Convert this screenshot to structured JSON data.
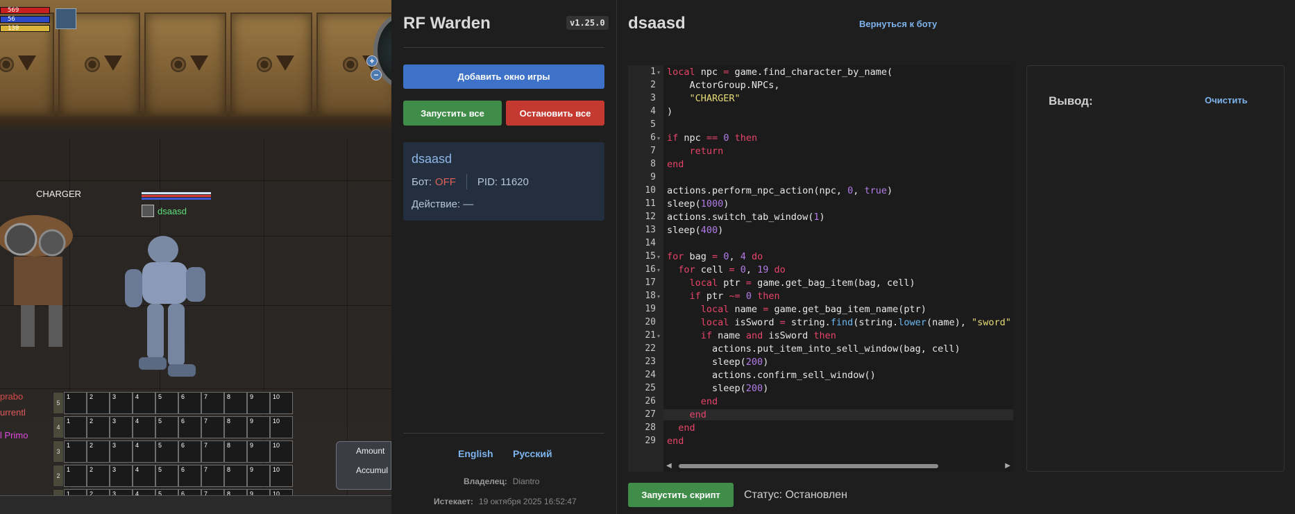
{
  "game": {
    "hp_values": [
      "569",
      "56",
      "130"
    ],
    "npc_label": "CHARGER",
    "player_name": "dsaasd",
    "chat_lines": [
      "prabo",
      "urrentl",
      "l Primo"
    ],
    "hotbar_labels": [
      "1",
      "2",
      "3",
      "4",
      "5",
      "6",
      "7",
      "8",
      "9",
      "10"
    ],
    "row_numbers": [
      "5",
      "4",
      "3",
      "2",
      "1"
    ],
    "amount_label": "Amount",
    "accumul_label": "Accumul"
  },
  "sidebar": {
    "app_title": "RF Warden",
    "version": "v1.25.0",
    "add_window_button": "Добавить окно игры",
    "start_all_button": "Запустить все",
    "stop_all_button": "Остановить все",
    "bot_card": {
      "name": "dsaasd",
      "bot_label": "Бот:",
      "bot_state": "OFF",
      "pid": "PID: 11620",
      "action": "Действие: —"
    },
    "languages": [
      "English",
      "Русский"
    ],
    "owner_label": "Владелец:",
    "owner_value": "Diantro",
    "expires_label": "Истекает:",
    "expires_value": "19 октября 2025 16:52:47"
  },
  "editor": {
    "script_title": "dsaasd",
    "back_link": "Вернуться к боту",
    "output_title": "Вывод:",
    "clear_link": "Очистить",
    "run_button": "Запустить скрипт",
    "status": "Статус: Остановлен",
    "fold_lines": [
      1,
      6,
      15,
      16,
      18,
      21
    ],
    "active_line": 27,
    "code": [
      [
        [
          "kw",
          "local"
        ],
        [
          "t",
          " npc "
        ],
        [
          "kw",
          "="
        ],
        [
          "t",
          " game.find_character_by_name("
        ]
      ],
      [
        [
          "t",
          "    ActorGroup.NPCs,"
        ]
      ],
      [
        [
          "t",
          "    "
        ],
        [
          "str",
          "\"CHARGER\""
        ]
      ],
      [
        [
          "t",
          ")"
        ]
      ],
      [],
      [
        [
          "kw",
          "if"
        ],
        [
          "t",
          " npc "
        ],
        [
          "kw",
          "=="
        ],
        [
          "t",
          " "
        ],
        [
          "num",
          "0"
        ],
        [
          "t",
          " "
        ],
        [
          "kw",
          "then"
        ]
      ],
      [
        [
          "t",
          "    "
        ],
        [
          "kw",
          "return"
        ]
      ],
      [
        [
          "kw",
          "end"
        ]
      ],
      [],
      [
        [
          "t",
          "actions.perform_npc_action(npc, "
        ],
        [
          "num",
          "0"
        ],
        [
          "t",
          ", "
        ],
        [
          "num",
          "true"
        ],
        [
          "t",
          ")"
        ]
      ],
      [
        [
          "t",
          "sleep("
        ],
        [
          "num",
          "1000"
        ],
        [
          "t",
          ")"
        ]
      ],
      [
        [
          "t",
          "actions.switch_tab_window("
        ],
        [
          "num",
          "1"
        ],
        [
          "t",
          ")"
        ]
      ],
      [
        [
          "t",
          "sleep("
        ],
        [
          "num",
          "400"
        ],
        [
          "t",
          ")"
        ]
      ],
      [],
      [
        [
          "kw",
          "for"
        ],
        [
          "t",
          " bag "
        ],
        [
          "kw",
          "="
        ],
        [
          "t",
          " "
        ],
        [
          "num",
          "0"
        ],
        [
          "t",
          ", "
        ],
        [
          "num",
          "4"
        ],
        [
          "t",
          " "
        ],
        [
          "kw",
          "do"
        ]
      ],
      [
        [
          "t",
          "  "
        ],
        [
          "kw",
          "for"
        ],
        [
          "t",
          " cell "
        ],
        [
          "kw",
          "="
        ],
        [
          "t",
          " "
        ],
        [
          "num",
          "0"
        ],
        [
          "t",
          ", "
        ],
        [
          "num",
          "19"
        ],
        [
          "t",
          " "
        ],
        [
          "kw",
          "do"
        ]
      ],
      [
        [
          "t",
          "    "
        ],
        [
          "kw",
          "local"
        ],
        [
          "t",
          " ptr "
        ],
        [
          "kw",
          "="
        ],
        [
          "t",
          " game.get_bag_item(bag, cell)"
        ]
      ],
      [
        [
          "t",
          "    "
        ],
        [
          "kw",
          "if"
        ],
        [
          "t",
          " ptr "
        ],
        [
          "kw",
          "~="
        ],
        [
          "t",
          " "
        ],
        [
          "num",
          "0"
        ],
        [
          "t",
          " "
        ],
        [
          "kw",
          "then"
        ]
      ],
      [
        [
          "t",
          "      "
        ],
        [
          "kw",
          "local"
        ],
        [
          "t",
          " name "
        ],
        [
          "kw",
          "="
        ],
        [
          "t",
          " game.get_bag_item_name(ptr)"
        ]
      ],
      [
        [
          "t",
          "      "
        ],
        [
          "kw",
          "local"
        ],
        [
          "t",
          " isSword "
        ],
        [
          "kw",
          "="
        ],
        [
          "t",
          " string."
        ],
        [
          "fn",
          "find"
        ],
        [
          "t",
          "(string."
        ],
        [
          "fn",
          "lower"
        ],
        [
          "t",
          "(name), "
        ],
        [
          "str",
          "\"sword\""
        ]
      ],
      [
        [
          "t",
          "      "
        ],
        [
          "kw",
          "if"
        ],
        [
          "t",
          " name "
        ],
        [
          "kw",
          "and"
        ],
        [
          "t",
          " isSword "
        ],
        [
          "kw",
          "then"
        ]
      ],
      [
        [
          "t",
          "        actions.put_item_into_sell_window(bag, cell)"
        ]
      ],
      [
        [
          "t",
          "        sleep("
        ],
        [
          "num",
          "200"
        ],
        [
          "t",
          ")"
        ]
      ],
      [
        [
          "t",
          "        actions.confirm_sell_window()"
        ]
      ],
      [
        [
          "t",
          "        sleep("
        ],
        [
          "num",
          "200"
        ],
        [
          "t",
          ")"
        ]
      ],
      [
        [
          "t",
          "      "
        ],
        [
          "kw",
          "end"
        ]
      ],
      [
        [
          "t",
          "    "
        ],
        [
          "kw",
          "end"
        ]
      ],
      [
        [
          "t",
          "  "
        ],
        [
          "kw",
          "end"
        ]
      ],
      [
        [
          "kw",
          "end"
        ]
      ]
    ]
  },
  "colors": {
    "accent_blue": "#3d72c8",
    "start_green": "#3f8d48",
    "stop_red": "#c43a31",
    "link_blue": "#7eb4ee",
    "keyword": "#e8446a",
    "number": "#b27ce8",
    "string": "#e6db74"
  }
}
